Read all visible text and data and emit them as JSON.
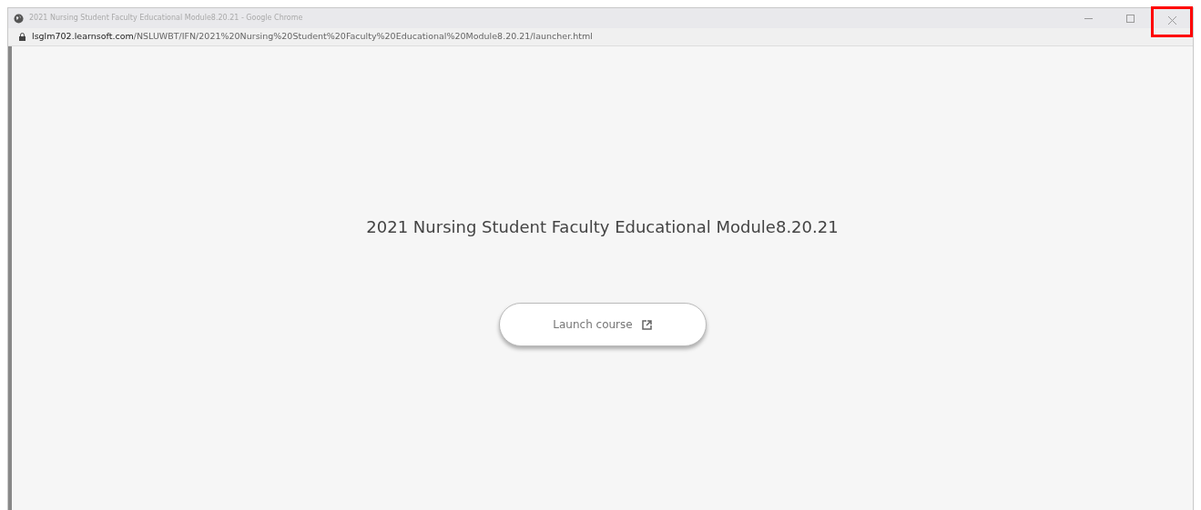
{
  "window": {
    "title": "2021 Nursing Student Faculty Educational Module8.20.21 - Google Chrome",
    "close_highlighted": true
  },
  "address_bar": {
    "domain": "lsglm702.learnsoft.com",
    "path": "/NSLUWBT/IFN/2021%20Nursing%20Student%20Faculty%20Educational%20Module8.20.21/launcher.html"
  },
  "page": {
    "heading": "2021 Nursing Student Faculty Educational Module8.20.21",
    "launch_button": "Launch course"
  }
}
